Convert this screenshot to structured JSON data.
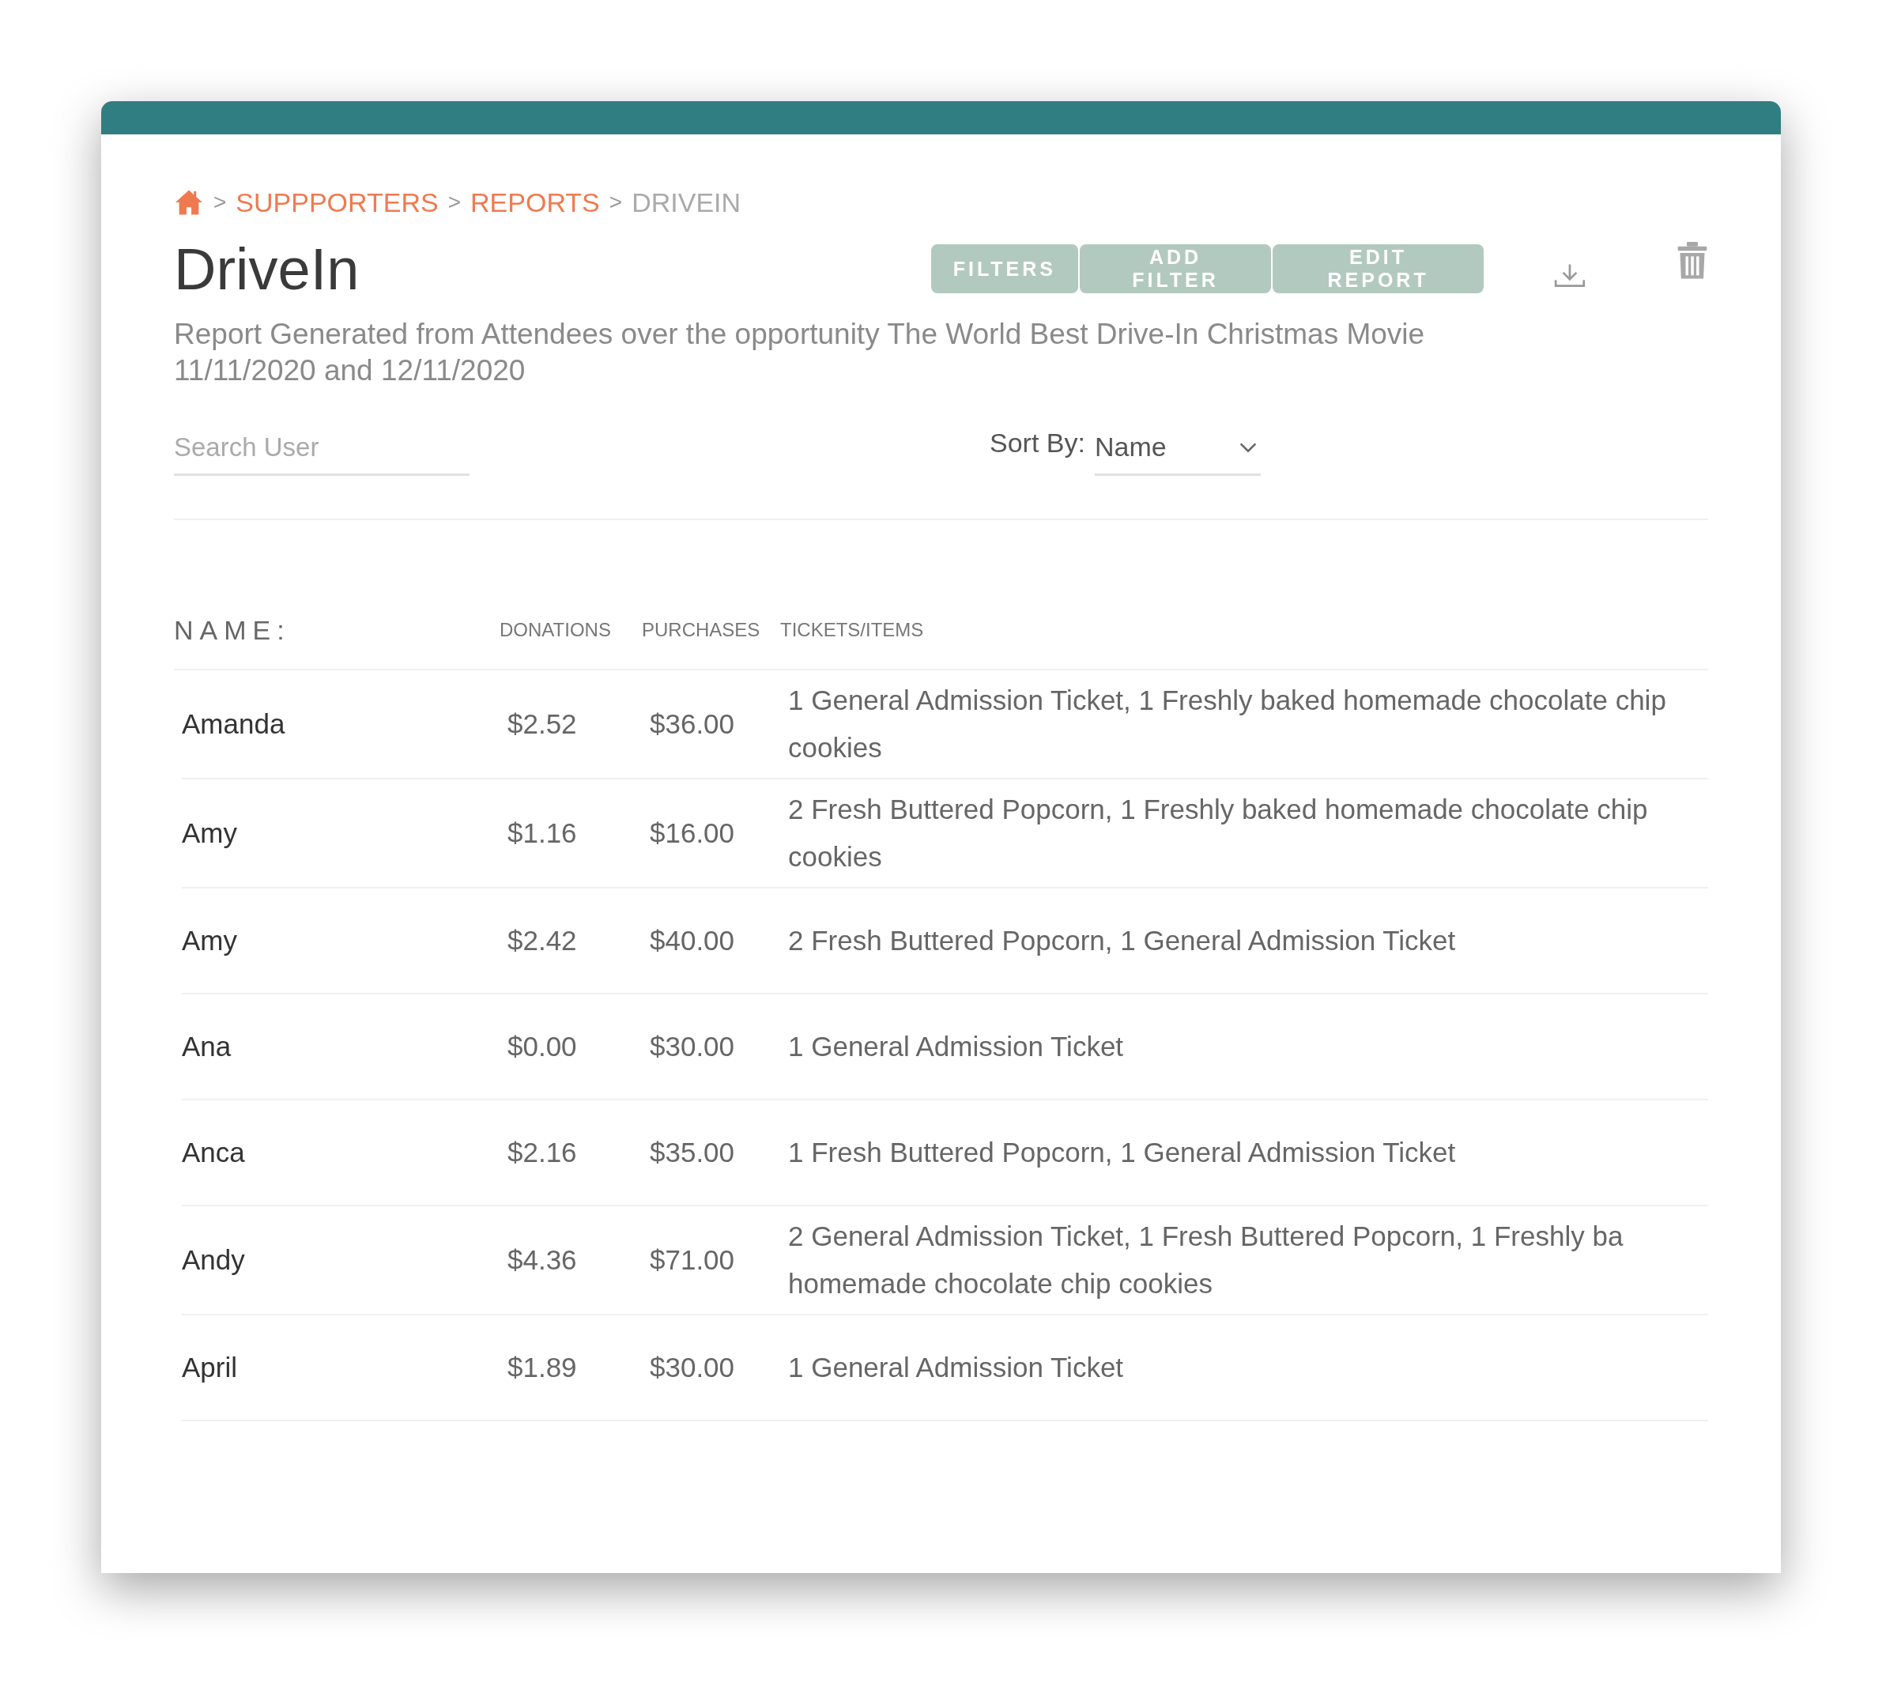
{
  "breadcrumb": [
    {
      "label": "SUPPPORTERS",
      "current": false
    },
    {
      "label": "REPORTS",
      "current": false
    },
    {
      "label": "DRIVEIN",
      "current": true
    }
  ],
  "breadcrumb_separator": ">",
  "title": "DriveIn",
  "actions": [
    "FILTERS",
    "ADD FILTER",
    "EDIT REPORT"
  ],
  "description": "Report Generated from Attendees over the opportunity The World Best Drive-In Christmas Movie 11/11/2020 and 12/11/2020",
  "search": {
    "placeholder": "Search User"
  },
  "sort": {
    "label": "Sort By:",
    "value": "Name"
  },
  "table": {
    "columns": [
      "NAME:",
      "DONATIONS",
      "PURCHASES",
      "TICKETS/ITEMS"
    ],
    "rows": [
      {
        "name": "Amanda",
        "donations": "$2.52",
        "purchases": "$36.00",
        "items": "1 General Admission Ticket, 1 Freshly baked homemade chocolate chip cookies"
      },
      {
        "name": "Amy",
        "donations": "$1.16",
        "purchases": "$16.00",
        "items": "2 Fresh Buttered Popcorn, 1 Freshly baked homemade chocolate chip cookies"
      },
      {
        "name": "Amy",
        "donations": "$2.42",
        "purchases": "$40.00",
        "items": "2 Fresh Buttered Popcorn, 1 General Admission Ticket"
      },
      {
        "name": "Ana",
        "donations": "$0.00",
        "purchases": "$30.00",
        "items": "1 General Admission Ticket"
      },
      {
        "name": "Anca",
        "donations": "$2.16",
        "purchases": "$35.00",
        "items": "1 Fresh Buttered Popcorn, 1 General Admission Ticket"
      },
      {
        "name": "Andy",
        "donations": "$4.36",
        "purchases": "$71.00",
        "items": "2 General Admission Ticket, 1 Fresh Buttered Popcorn, 1 Freshly ba homemade chocolate chip cookies"
      },
      {
        "name": "April",
        "donations": "$1.89",
        "purchases": "$30.00",
        "items": "1 General Admission Ticket"
      }
    ]
  }
}
